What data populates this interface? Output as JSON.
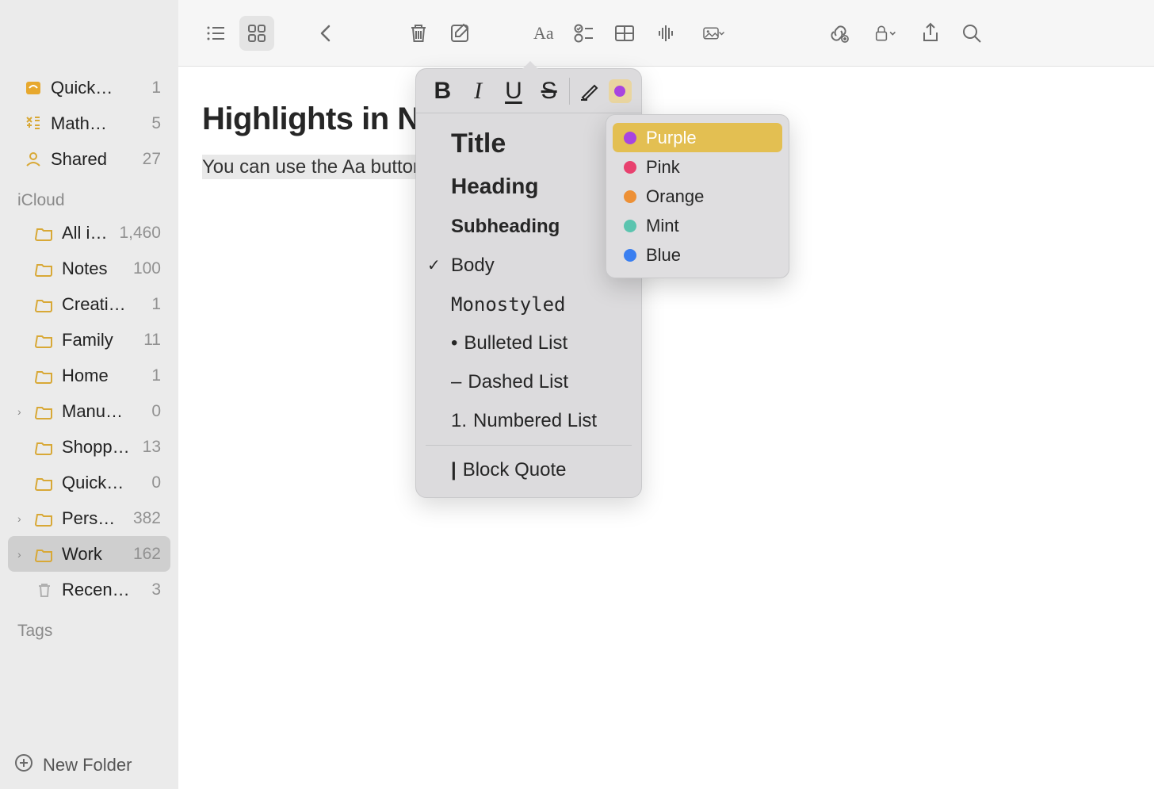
{
  "sidebar": {
    "top": [
      {
        "label": "Quick…",
        "count": "1",
        "icon": "quicknote"
      },
      {
        "label": "Math…",
        "count": "5",
        "icon": "math"
      },
      {
        "label": "Shared",
        "count": "27",
        "icon": "shared"
      }
    ],
    "section1": "iCloud",
    "folders": [
      {
        "label": "All i…",
        "count": "1,460",
        "chev": false
      },
      {
        "label": "Notes",
        "count": "100",
        "chev": false
      },
      {
        "label": "Creati…",
        "count": "1",
        "chev": false
      },
      {
        "label": "Family",
        "count": "11",
        "chev": false
      },
      {
        "label": "Home",
        "count": "1",
        "chev": false
      },
      {
        "label": "Manu…",
        "count": "0",
        "chev": true
      },
      {
        "label": "Shopp…",
        "count": "13",
        "chev": false
      },
      {
        "label": "Quick…",
        "count": "0",
        "chev": false
      },
      {
        "label": "Pers…",
        "count": "382",
        "chev": true
      },
      {
        "label": "Work",
        "count": "162",
        "chev": true,
        "selected": true
      }
    ],
    "trash": {
      "label": "Recen…",
      "count": "3"
    },
    "section2": "Tags",
    "footer": "New Folder"
  },
  "note": {
    "title": "Highlights in Note",
    "body": "You can use the Aa button"
  },
  "format": {
    "styles": {
      "title": "Title",
      "heading": "Heading",
      "subheading": "Subheading",
      "body": "Body",
      "mono": "Monostyled",
      "bulleted": "Bulleted List",
      "dashed": "Dashed List",
      "numbered": "Numbered List",
      "block": "Block Quote"
    },
    "bullet_prefix": "•",
    "dash_prefix": "–",
    "number_prefix": "1.",
    "block_prefix": "|",
    "selected": "body"
  },
  "colors": {
    "items": [
      {
        "label": "Purple",
        "hex": "#a845e0",
        "selected": true
      },
      {
        "label": "Pink",
        "hex": "#e8416f"
      },
      {
        "label": "Orange",
        "hex": "#ed9036"
      },
      {
        "label": "Mint",
        "hex": "#5bc4af"
      },
      {
        "label": "Blue",
        "hex": "#3a7ff0"
      }
    ]
  }
}
